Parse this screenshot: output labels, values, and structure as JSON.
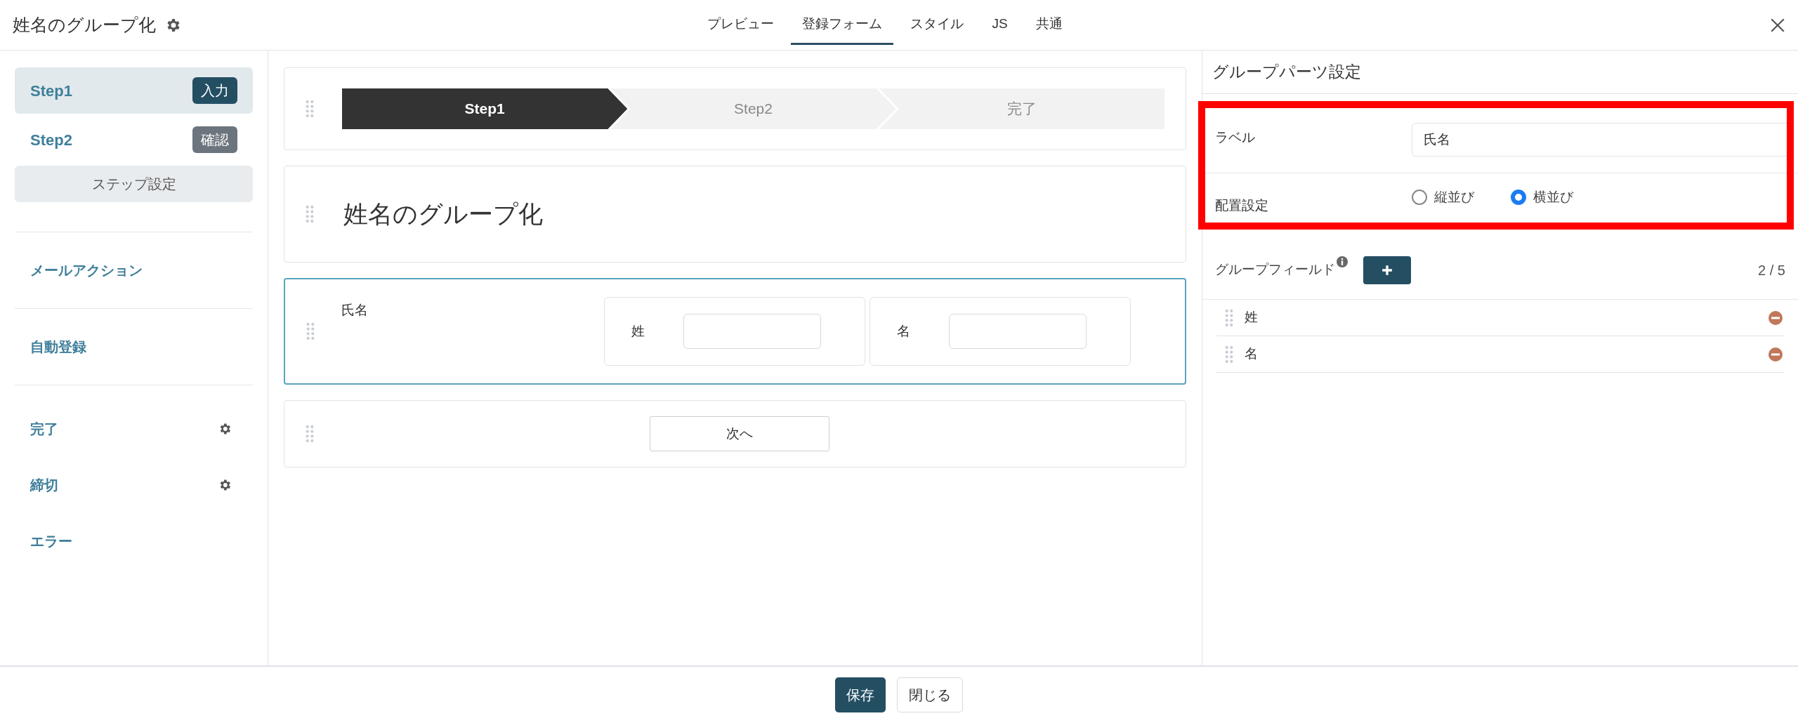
{
  "header": {
    "title": "姓名のグループ化",
    "tabs": [
      {
        "label": "プレビュー",
        "selected": false
      },
      {
        "label": "登録フォーム",
        "selected": true
      },
      {
        "label": "スタイル",
        "selected": false
      },
      {
        "label": "JS",
        "selected": false
      },
      {
        "label": "共通",
        "selected": false
      }
    ]
  },
  "sidebar": {
    "steps": [
      {
        "label": "Step1",
        "badge": "入力",
        "selected": true
      },
      {
        "label": "Step2",
        "badge": "確認",
        "selected": false
      }
    ],
    "step_settings": "ステップ設定",
    "groups": [
      {
        "items": [
          {
            "label": "メールアクション",
            "has_settings": false
          }
        ]
      },
      {
        "items": [
          {
            "label": "自動登録",
            "has_settings": false
          }
        ]
      },
      {
        "items": [
          {
            "label": "完了",
            "has_settings": true
          },
          {
            "label": "締切",
            "has_settings": true
          },
          {
            "label": "エラー",
            "has_settings": false
          }
        ]
      }
    ]
  },
  "canvas": {
    "progress": [
      {
        "label": "Step1",
        "selected": true
      },
      {
        "label": "Step2",
        "selected": false
      },
      {
        "label": "完了",
        "selected": false
      }
    ],
    "heading": "姓名のグループ化",
    "group_field": {
      "label": "氏名",
      "selected": true,
      "subfields": [
        {
          "label": "姓"
        },
        {
          "label": "名"
        }
      ]
    },
    "next_button": "次へ"
  },
  "settings": {
    "title": "グループパーツ設定",
    "label_field": {
      "label": "ラベル",
      "value": "氏名"
    },
    "layout": {
      "label": "配置設定",
      "options": [
        {
          "label": "縦並び",
          "selected": false
        },
        {
          "label": "横並び",
          "selected": true
        }
      ]
    },
    "group_fields": {
      "label": "グループフィールド",
      "count": "2 / 5",
      "items": [
        {
          "label": "姓"
        },
        {
          "label": "名"
        }
      ]
    }
  },
  "footer": {
    "buttons": [
      {
        "label": "保存",
        "kind": "primary"
      },
      {
        "label": "閉じる",
        "kind": "secondary"
      }
    ]
  }
}
